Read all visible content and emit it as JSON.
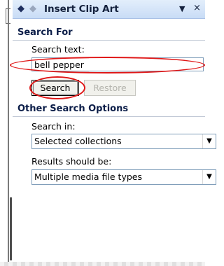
{
  "panel": {
    "title": "Insert Clip Art",
    "nav_back_icon": "back-arrow-icon",
    "nav_forward_icon": "forward-arrow-icon",
    "menu_icon": "dropdown-icon",
    "close_label": "×"
  },
  "search_for": {
    "heading": "Search For",
    "search_text_label": "Search text:",
    "search_text_value": "bell pepper",
    "search_button": "Search",
    "restore_button": "Restore"
  },
  "other_options": {
    "heading": "Other Search Options",
    "search_in_label": "Search in:",
    "search_in_value": "Selected collections",
    "results_label": "Results should be:",
    "results_value": "Multiple media file types"
  },
  "annotation": {
    "ellipse_color": "#e01818"
  }
}
